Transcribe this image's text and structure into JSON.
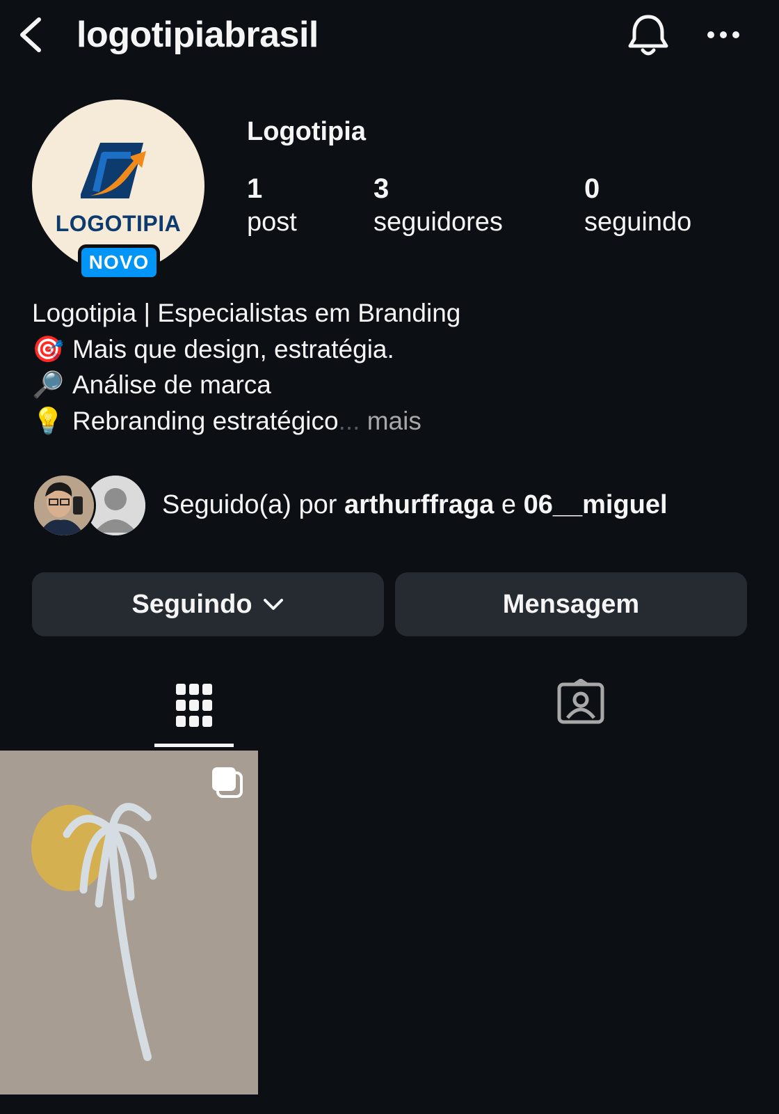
{
  "header": {
    "username": "logotipiabrasil",
    "back_icon": "chevron-left-icon",
    "bell_icon": "bell-icon",
    "more_icon": "more-horizontal-icon"
  },
  "profile": {
    "avatar_logo_text": "LOGOTIPIA",
    "badge": "NOVO",
    "display_name": "Logotipia",
    "stats": {
      "posts": {
        "count": "1",
        "label": "post"
      },
      "followers": {
        "count": "3",
        "label": "seguidores"
      },
      "following": {
        "count": "0",
        "label": "seguindo"
      }
    },
    "bio": {
      "line1": "Logotipia | Especialistas em Branding",
      "line2": "Mais que design, estratégia.",
      "line3": "Análise de marca",
      "line4": "Rebranding estratégico",
      "ellipsis": "...",
      "more": "mais",
      "emoji2": "🎯",
      "emoji3": "🔎",
      "emoji4": "💡"
    },
    "followed_by": {
      "prefix": "Seguido(a) por",
      "user1": "arthurffraga",
      "joiner": "e",
      "user2": "06__miguel"
    }
  },
  "actions": {
    "following_label": "Seguindo",
    "message_label": "Mensagem"
  },
  "tabs": {
    "grid_icon": "grid-icon",
    "tagged_icon": "tagged-person-icon"
  },
  "posts": [
    {
      "type": "carousel",
      "indicator_icon": "multiple-images-icon"
    }
  ],
  "colors": {
    "background": "#0c1014",
    "button": "#262b31",
    "badge": "#0095f6",
    "muted": "#a8a8a8"
  }
}
